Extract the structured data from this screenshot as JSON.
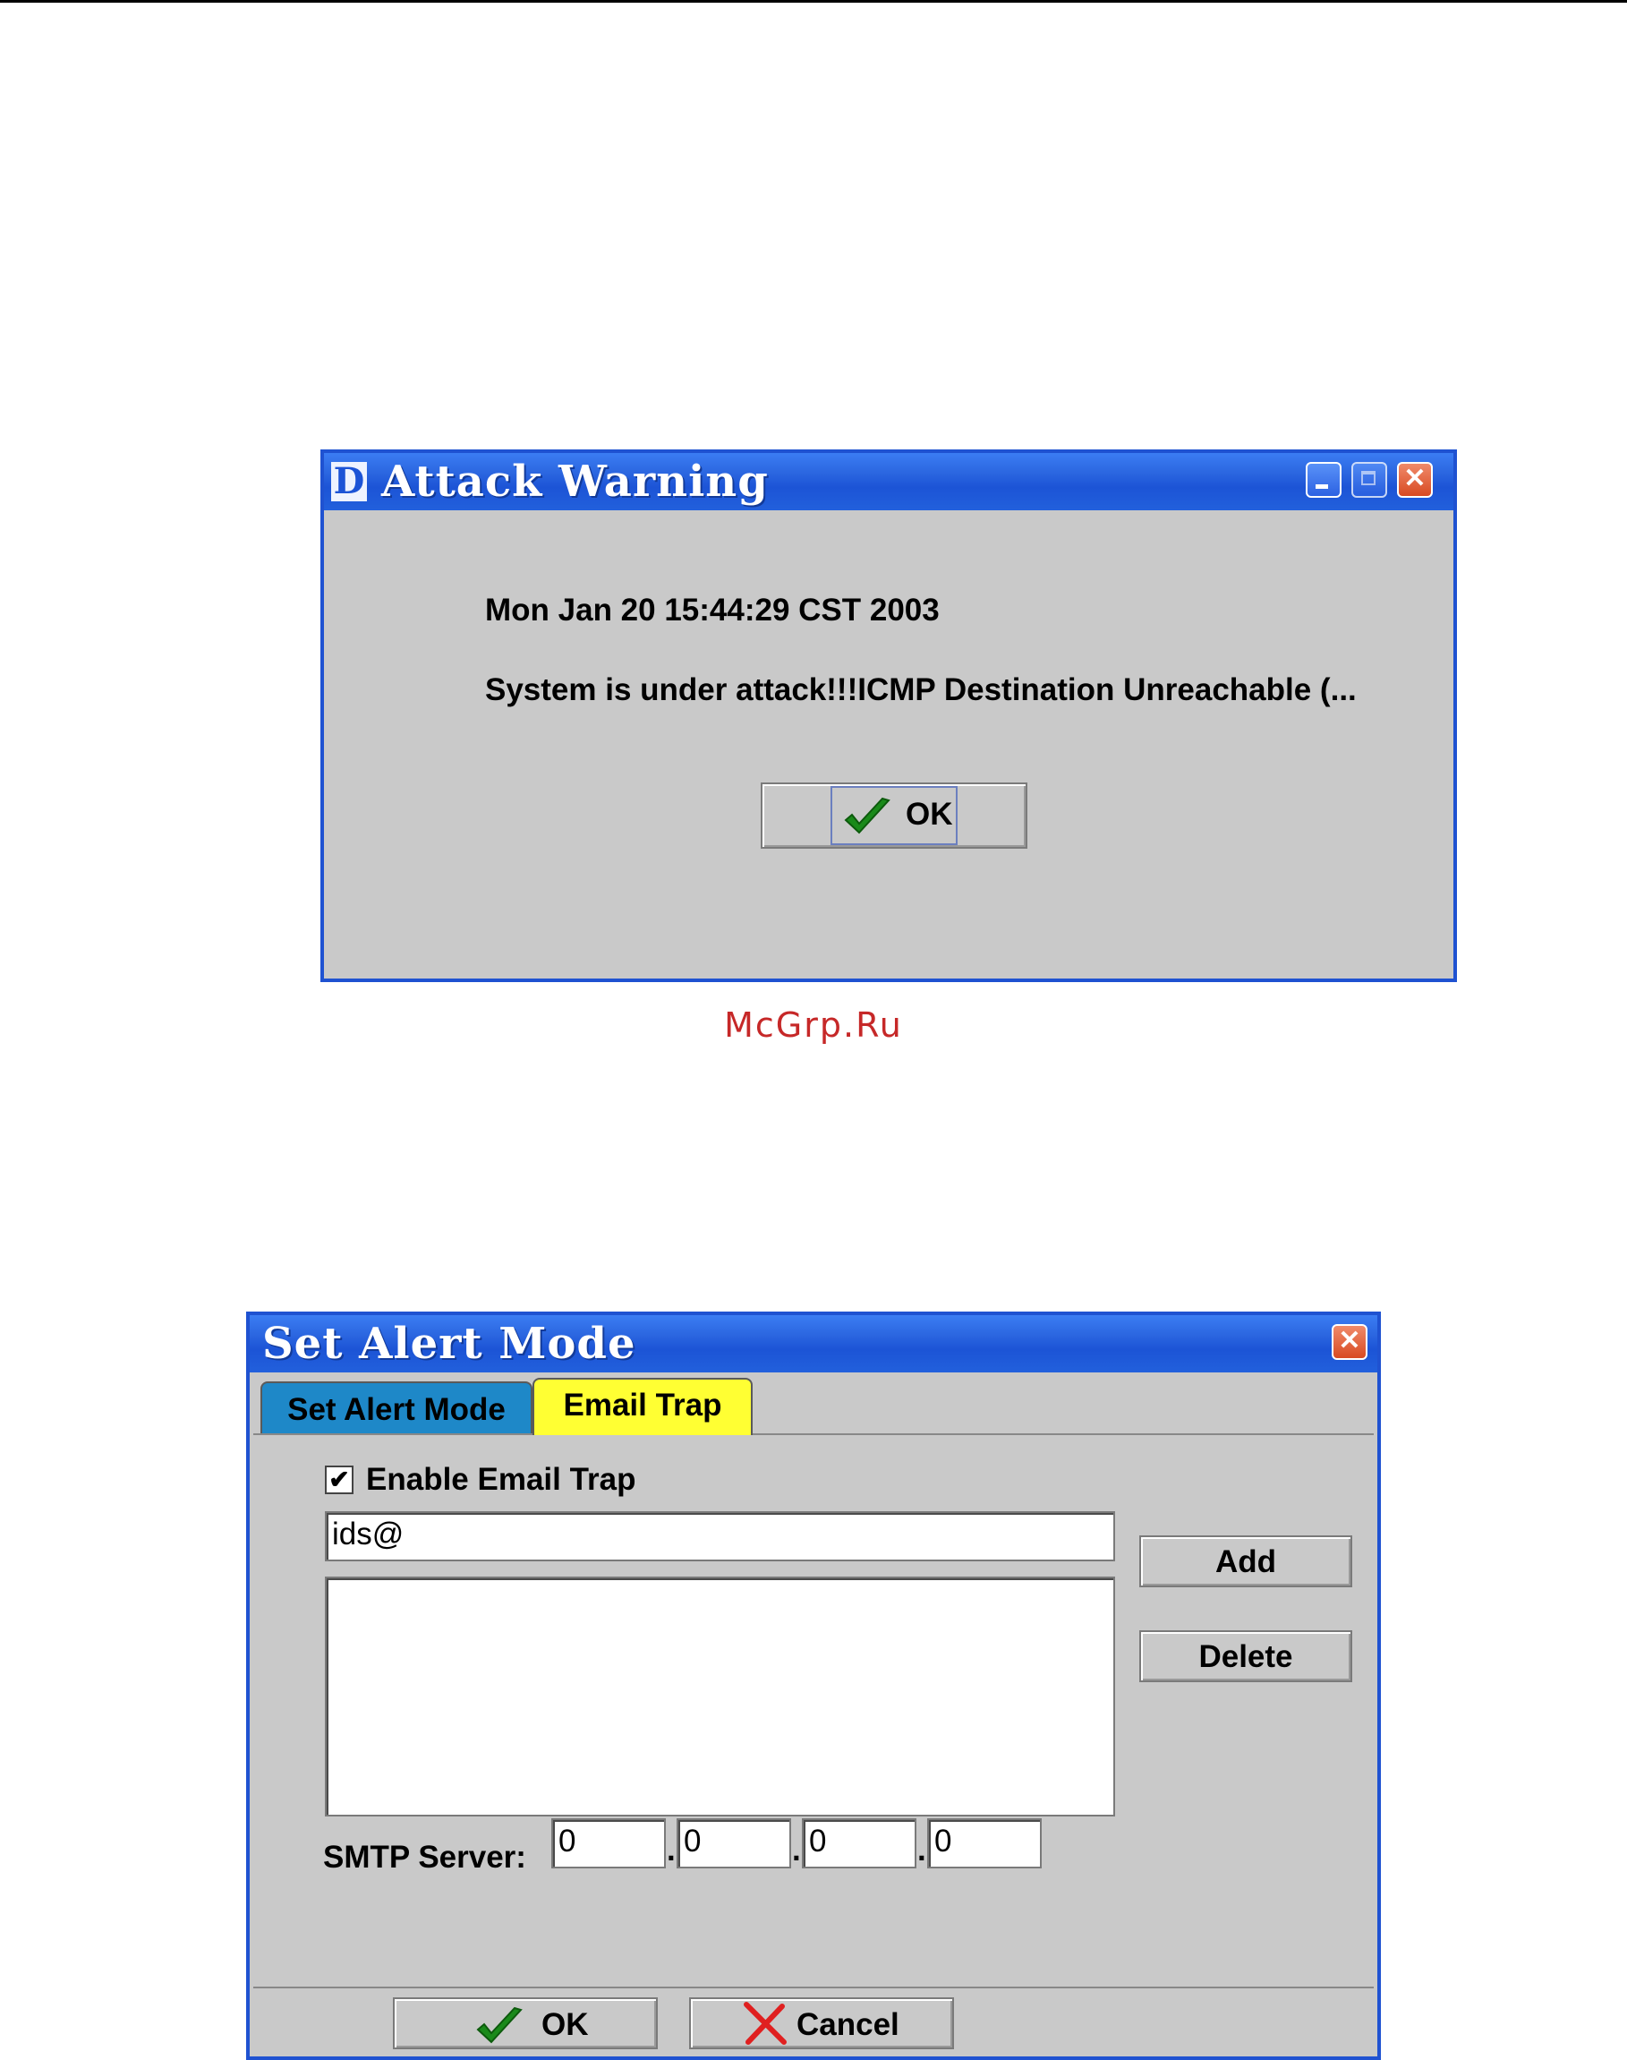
{
  "attack_warning": {
    "logo": "D",
    "title": "Attack Warning",
    "timestamp": "Mon Jan 20 15:44:29 CST 2003",
    "message": "System is under attack!!!ICMP Destination Unreachable (...",
    "ok_label": "OK",
    "icons": [
      "minimize-icon",
      "maximize-icon",
      "close-icon",
      "checkmark-icon"
    ]
  },
  "watermark": "McGrp.Ru",
  "set_alert_mode": {
    "title": "Set Alert Mode",
    "tabs": [
      {
        "label": "Set Alert Mode",
        "active": false,
        "color": "#1e88c8"
      },
      {
        "label": "Email Trap",
        "active": true,
        "color": "#ffff33"
      }
    ],
    "enable_email_trap_label": "Enable Email Trap",
    "enable_email_trap_checked": true,
    "checkbox_mark": "✔",
    "email_input_value": "ids@",
    "email_list": [],
    "add_label": "Add",
    "delete_label": "Delete",
    "smtp_label": "SMTP Server:",
    "smtp_octets": [
      "0",
      "0",
      "0",
      "0"
    ],
    "ok_label": "OK",
    "cancel_label": "Cancel"
  },
  "colors": {
    "titlebar": "#1c54d6",
    "dialog_bg": "#c9c9c9",
    "ok_check": "#1a8a1a",
    "cancel_x": "#e02020",
    "watermark": "#c62828"
  }
}
